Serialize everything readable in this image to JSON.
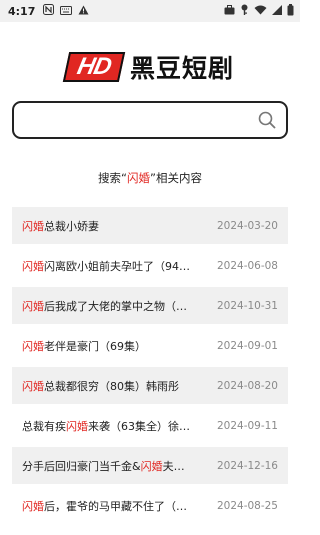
{
  "status_bar": {
    "time": "4:17",
    "icons_left": [
      "notification-n-icon",
      "keyboard-icon",
      "warning-icon"
    ],
    "icons_right": [
      "briefcase-icon",
      "key-icon",
      "wifi-icon",
      "signal-icon",
      "battery-icon"
    ]
  },
  "logo": {
    "badge": "HD",
    "name": "黑豆短剧"
  },
  "search": {
    "value": "",
    "placeholder": ""
  },
  "results_header": {
    "prefix": "搜索“",
    "keyword": "闪婚",
    "suffix": "”相关内容"
  },
  "results": [
    {
      "parts": [
        {
          "t": "闪婚",
          "hl": true
        },
        {
          "t": "总裁小娇妻",
          "hl": false
        }
      ],
      "date": "2024-03-20",
      "shade": "gray"
    },
    {
      "parts": [
        {
          "t": "闪婚",
          "hl": true
        },
        {
          "t": "闪离欧小姐前夫孕吐了（94…",
          "hl": false
        }
      ],
      "date": "2024-06-08",
      "shade": "white"
    },
    {
      "parts": [
        {
          "t": "闪婚",
          "hl": true
        },
        {
          "t": "后我成了大佬的掌中之物（…",
          "hl": false
        }
      ],
      "date": "2024-10-31",
      "shade": "gray"
    },
    {
      "parts": [
        {
          "t": "闪婚",
          "hl": true
        },
        {
          "t": "老伴是豪门（69集）",
          "hl": false
        }
      ],
      "date": "2024-09-01",
      "shade": "white"
    },
    {
      "parts": [
        {
          "t": "闪婚",
          "hl": true
        },
        {
          "t": "总裁都很穷（80集）韩雨彤",
          "hl": false
        }
      ],
      "date": "2024-08-20",
      "shade": "gray"
    },
    {
      "parts": [
        {
          "t": "总裁有疾",
          "hl": false
        },
        {
          "t": "闪婚",
          "hl": true
        },
        {
          "t": "来袭（63集全）徐…",
          "hl": false
        }
      ],
      "date": "2024-09-11",
      "shade": "white"
    },
    {
      "parts": [
        {
          "t": "分手后回归豪门当千金&",
          "hl": false
        },
        {
          "t": "闪婚",
          "hl": true
        },
        {
          "t": "夫…",
          "hl": false
        }
      ],
      "date": "2024-12-16",
      "shade": "gray"
    },
    {
      "parts": [
        {
          "t": "闪婚",
          "hl": true
        },
        {
          "t": "后，霍爷的马甲藏不住了（…",
          "hl": false
        }
      ],
      "date": "2024-08-25",
      "shade": "white"
    }
  ],
  "colors": {
    "accent": "#e12722",
    "row_gray": "#f0f0f0",
    "date_text": "#8a8a8a"
  }
}
